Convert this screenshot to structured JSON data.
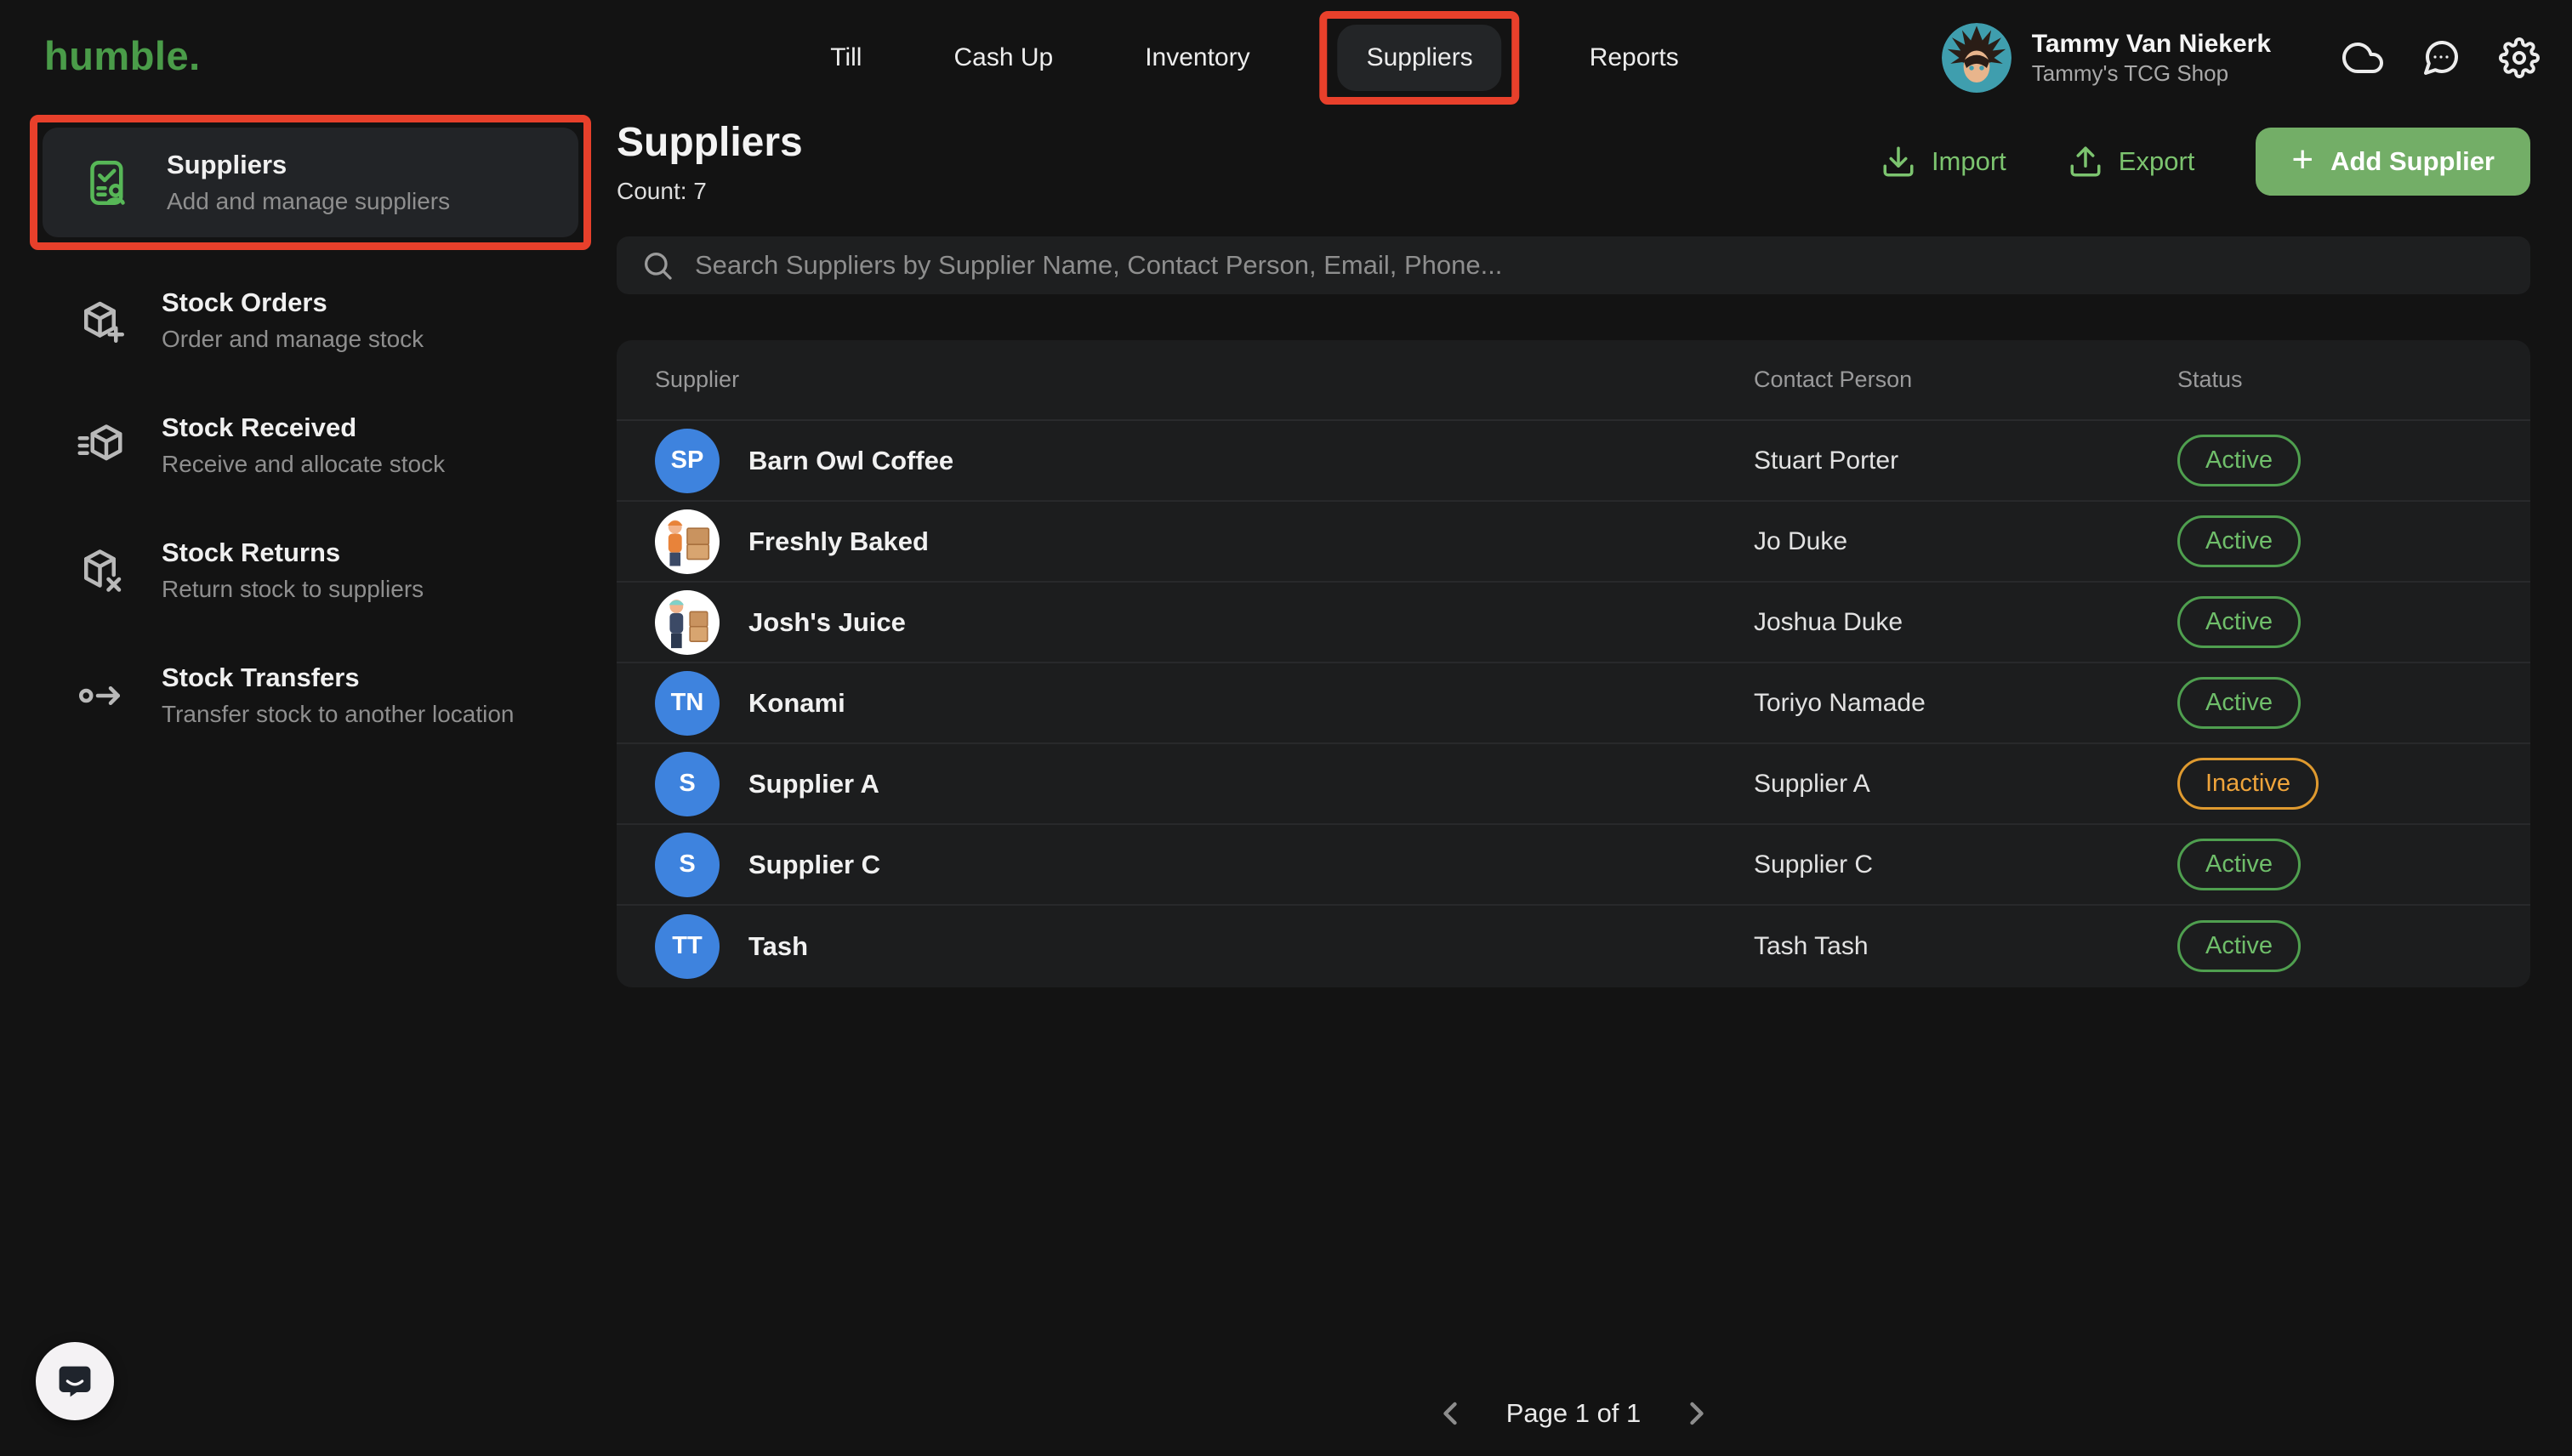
{
  "brand": {
    "logo": "humble."
  },
  "nav": {
    "items": [
      {
        "label": "Till"
      },
      {
        "label": "Cash Up"
      },
      {
        "label": "Inventory"
      },
      {
        "label": "Suppliers"
      },
      {
        "label": "Reports"
      }
    ],
    "active_item": "Suppliers"
  },
  "user": {
    "name": "Tammy Van Niekerk",
    "shop": "Tammy's TCG Shop",
    "avatar": "anime-character-avatar"
  },
  "top_icons": [
    {
      "name": "cloud-icon"
    },
    {
      "name": "chat-icon"
    },
    {
      "name": "gear-icon"
    }
  ],
  "sidebar": {
    "items": [
      {
        "title": "Suppliers",
        "desc": "Add and manage suppliers",
        "icon": "suppliers-contact-icon",
        "selected": true
      },
      {
        "title": "Stock Orders",
        "desc": "Order and manage stock",
        "icon": "stock-orders-icon",
        "selected": false
      },
      {
        "title": "Stock Received",
        "desc": "Receive and allocate stock",
        "icon": "stock-received-icon",
        "selected": false
      },
      {
        "title": "Stock Returns",
        "desc": "Return stock to suppliers",
        "icon": "stock-returns-icon",
        "selected": false
      },
      {
        "title": "Stock Transfers",
        "desc": "Transfer stock to another location",
        "icon": "stock-transfers-icon",
        "selected": false
      }
    ]
  },
  "header": {
    "title": "Suppliers",
    "count": "Count: 7",
    "import_label": "Import",
    "export_label": "Export",
    "add_label": "Add Supplier"
  },
  "search": {
    "placeholder": "Search Suppliers by Supplier Name, Contact Person, Email, Phone..."
  },
  "table": {
    "columns": [
      "Supplier",
      "Contact Person",
      "Status"
    ],
    "rows": [
      {
        "name": "Barn Owl Coffee",
        "avatar": {
          "type": "initials",
          "text": "SP"
        },
        "contact": "Stuart Porter",
        "status": "Active"
      },
      {
        "name": "Freshly Baked",
        "avatar": {
          "type": "image",
          "desc": "delivery-person-with-boxes-illustration"
        },
        "contact": "Jo Duke",
        "status": "Active"
      },
      {
        "name": "Josh's Juice",
        "avatar": {
          "type": "image",
          "desc": "worker-with-boxes-illustration"
        },
        "contact": "Joshua Duke",
        "status": "Active"
      },
      {
        "name": "Konami",
        "avatar": {
          "type": "initials",
          "text": "TN"
        },
        "contact": "Toriyo Namade",
        "status": "Active"
      },
      {
        "name": "Supplier A",
        "avatar": {
          "type": "initials",
          "text": "S"
        },
        "contact": "Supplier A",
        "status": "Inactive"
      },
      {
        "name": "Supplier C",
        "avatar": {
          "type": "initials",
          "text": "S"
        },
        "contact": "Supplier C",
        "status": "Active"
      },
      {
        "name": "Tash",
        "avatar": {
          "type": "initials",
          "text": "TT"
        },
        "contact": "Tash Tash",
        "status": "Active"
      }
    ]
  },
  "pagination": {
    "label": "Page 1 of 1"
  },
  "annotations": {
    "color": "#E8402B",
    "nav_item": "Suppliers",
    "sidebar_item": "Suppliers"
  },
  "colors": {
    "background": "#131313",
    "panel": "#1C1D1E",
    "accent_green": "#4A9C49",
    "button_green": "#73AE67",
    "link_green": "#7CC46F",
    "badge_active": "#6FBE6A",
    "badge_inactive": "#EFA43B",
    "avatar_blue": "#3E83DE",
    "annotation_red": "#E8402B"
  }
}
